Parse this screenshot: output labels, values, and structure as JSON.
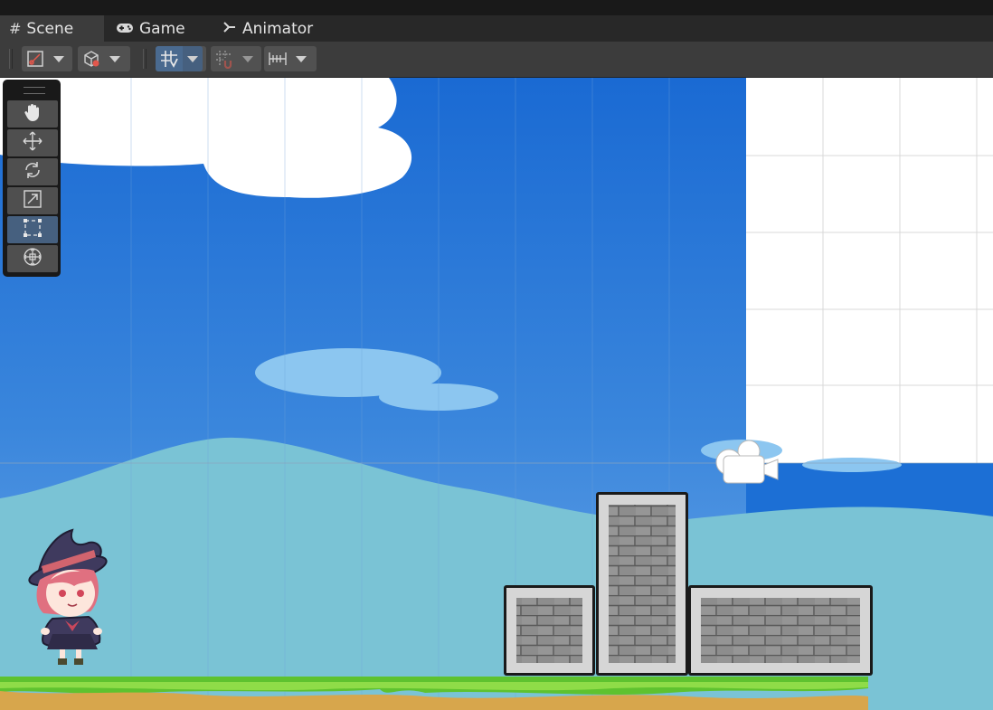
{
  "tabs": [
    {
      "label": "Scene",
      "icon": "grid-hash-icon",
      "active": true
    },
    {
      "label": "Game",
      "icon": "gamepad-icon",
      "active": false
    },
    {
      "label": "Animator",
      "icon": "animator-icon",
      "active": false
    }
  ],
  "toolbar": {
    "buttons": [
      {
        "name": "draw-mode-button",
        "icon": "draw-mode-icon"
      },
      {
        "name": "scene-view-button",
        "icon": "cube-icon"
      },
      {
        "name": "grid-visibility-button",
        "icon": "grid-toggle-icon",
        "active": true
      },
      {
        "name": "grid-snapping-button",
        "icon": "snap-grid-icon"
      },
      {
        "name": "increment-snapping-button",
        "icon": "increment-snap-icon"
      }
    ]
  },
  "tools": [
    {
      "name": "hand-tool",
      "icon": "hand-icon"
    },
    {
      "name": "move-tool",
      "icon": "move-arrows-icon"
    },
    {
      "name": "rotate-tool",
      "icon": "rotate-icon"
    },
    {
      "name": "scale-tool",
      "icon": "scale-icon"
    },
    {
      "name": "rect-tool",
      "icon": "rect-transform-icon",
      "selected": true
    },
    {
      "name": "transform-tool",
      "icon": "transform-icon"
    }
  ],
  "colors": {
    "sky_top": "#1c6fd5",
    "sky_bottom": "#5ea1e6",
    "hills": "#7cc4d6",
    "grass": "#5fc42f",
    "dirt": "#d6a74d",
    "brick": "#8f8f8f",
    "accent_selected": "#46607f"
  }
}
